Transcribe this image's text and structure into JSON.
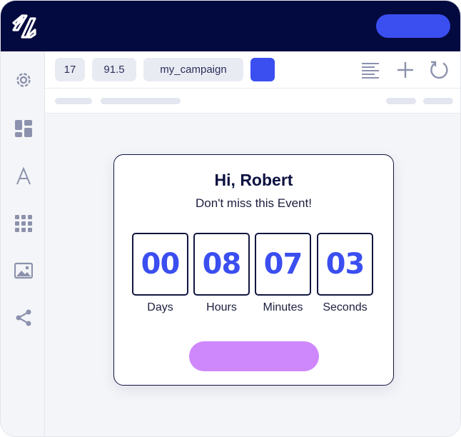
{
  "toolbar": {
    "chips": [
      "17",
      "91.5",
      "my_campaign"
    ],
    "swatch_color": "#3b4ef0",
    "tools": [
      "align-left-icon",
      "plus-icon",
      "refresh-icon"
    ]
  },
  "sidebar": {
    "items": [
      "gear-icon",
      "layout-icon",
      "text-icon",
      "grid-icon",
      "image-icon",
      "share-icon"
    ]
  },
  "card": {
    "greeting": "Hi, Robert",
    "subtitle": "Don't miss this Event!",
    "countdown": [
      {
        "value": "00",
        "label": "Days"
      },
      {
        "value": "08",
        "label": "Hours"
      },
      {
        "value": "07",
        "label": "Minutes"
      },
      {
        "value": "03",
        "label": "Seconds"
      }
    ]
  },
  "colors": {
    "topbar": "#030a3f",
    "accent": "#3b4ef0",
    "cta": "#cf88fb"
  }
}
